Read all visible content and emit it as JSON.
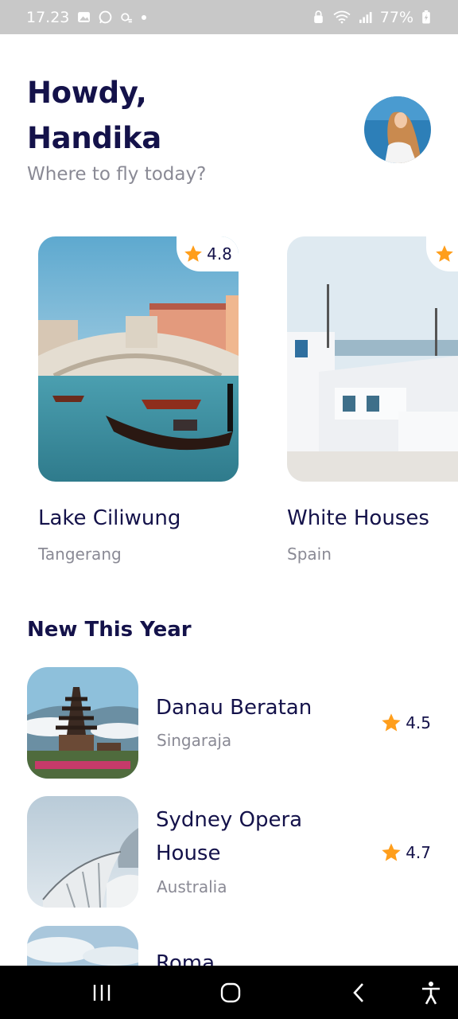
{
  "status_bar": {
    "time": "17.23",
    "battery": "77%"
  },
  "header": {
    "greeting_line1": "Howdy,",
    "greeting_line2": "Handika",
    "subtitle": "Where to fly today?"
  },
  "featured": [
    {
      "title": "Lake Ciliwung",
      "location": "Tangerang",
      "rating": "4.8"
    },
    {
      "title": "White Houses",
      "location": "Spain",
      "rating": ""
    }
  ],
  "section": {
    "title": "New This Year"
  },
  "new_this_year": [
    {
      "title": "Danau Beratan",
      "location": "Singaraja",
      "rating": "4.5"
    },
    {
      "title": "Sydney Opera House",
      "location": "Australia",
      "rating": "4.7"
    },
    {
      "title": "Roma",
      "location": "",
      "rating": ""
    }
  ],
  "colors": {
    "primary_text": "#14124a",
    "secondary_text": "#8a8a95",
    "star": "#ff9e1b"
  }
}
